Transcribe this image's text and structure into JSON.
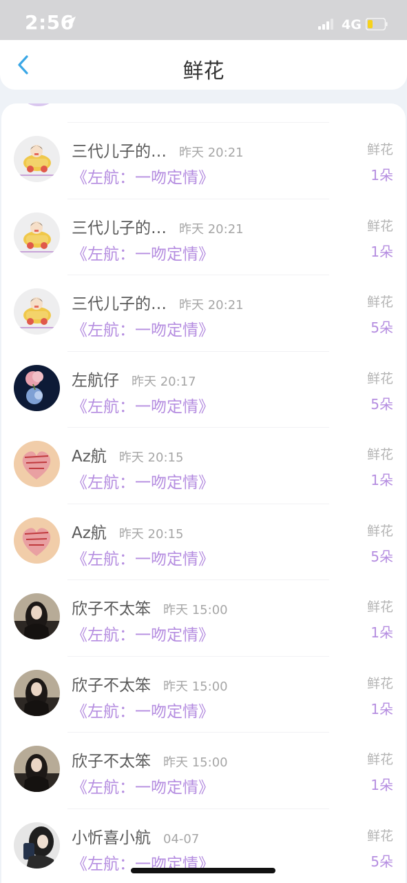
{
  "status_bar": {
    "time": "2:56",
    "network": "4G",
    "battery_color": "#f6d21b"
  },
  "header": {
    "title": "鲜花",
    "accent_color": "#3aa7e6"
  },
  "rows": [
    {
      "name": "三代儿子的…",
      "time": "昨天 20:21",
      "source": "《左航：一吻定情》",
      "gift_type": "鲜花",
      "count": "1朵",
      "avatar_icon": "cartoon-car-avatar"
    },
    {
      "name": "三代儿子的…",
      "time": "昨天 20:21",
      "source": "《左航：一吻定情》",
      "gift_type": "鲜花",
      "count": "1朵",
      "avatar_icon": "cartoon-car-avatar"
    },
    {
      "name": "三代儿子的…",
      "time": "昨天 20:21",
      "source": "《左航：一吻定情》",
      "gift_type": "鲜花",
      "count": "5朵",
      "avatar_icon": "cartoon-car-avatar"
    },
    {
      "name": "左航仔",
      "time": "昨天 20:17",
      "source": "《左航：一吻定情》",
      "gift_type": "鲜花",
      "count": "5朵",
      "avatar_icon": "flower-photo-avatar"
    },
    {
      "name": "Az航",
      "time": "昨天 20:15",
      "source": "《左航：一吻定情》",
      "gift_type": "鲜花",
      "count": "1朵",
      "avatar_icon": "heart-art-avatar"
    },
    {
      "name": "Az航",
      "time": "昨天 20:15",
      "source": "《左航：一吻定情》",
      "gift_type": "鲜花",
      "count": "5朵",
      "avatar_icon": "heart-art-avatar"
    },
    {
      "name": "欣子不太笨",
      "time": "昨天 15:00",
      "source": "《左航：一吻定情》",
      "gift_type": "鲜花",
      "count": "1朵",
      "avatar_icon": "person-photo-avatar"
    },
    {
      "name": "欣子不太笨",
      "time": "昨天 15:00",
      "source": "《左航：一吻定情》",
      "gift_type": "鲜花",
      "count": "1朵",
      "avatar_icon": "person-photo-avatar"
    },
    {
      "name": "欣子不太笨",
      "time": "昨天 15:00",
      "source": "《左航：一吻定情》",
      "gift_type": "鲜花",
      "count": "1朵",
      "avatar_icon": "person-photo-avatar"
    },
    {
      "name": "小忻喜小航",
      "time": "04-07",
      "source": "《左航：一吻定情》",
      "gift_type": "鲜花",
      "count": "5朵",
      "avatar_icon": "selfie-photo-avatar"
    }
  ]
}
